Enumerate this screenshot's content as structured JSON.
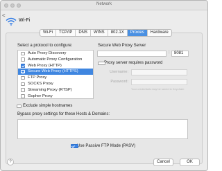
{
  "window": {
    "title": "Network"
  },
  "header": {
    "back_label": "<",
    "interface_name": "Wi-Fi"
  },
  "tabs": [
    {
      "label": "Wi-Fi",
      "active": false
    },
    {
      "label": "TCP/IP",
      "active": false
    },
    {
      "label": "DNS",
      "active": false
    },
    {
      "label": "WINS",
      "active": false
    },
    {
      "label": "802.1X",
      "active": false
    },
    {
      "label": "Proxies",
      "active": true
    },
    {
      "label": "Hardware",
      "active": false
    }
  ],
  "protocols": {
    "heading": "Select a protocol to configure:",
    "items": [
      {
        "label": "Auto Proxy Discovery",
        "checked": false,
        "selected": false
      },
      {
        "label": "Automatic Proxy Configuration",
        "checked": false,
        "selected": false
      },
      {
        "label": "Web Proxy (HTTP)",
        "checked": true,
        "selected": false
      },
      {
        "label": "Secure Web Proxy (HTTPS)",
        "checked": true,
        "selected": true
      },
      {
        "label": "FTP Proxy",
        "checked": false,
        "selected": false
      },
      {
        "label": "SOCKS Proxy",
        "checked": false,
        "selected": false
      },
      {
        "label": "Streaming Proxy (RTSP)",
        "checked": false,
        "selected": false
      },
      {
        "label": "Gopher Proxy",
        "checked": false,
        "selected": false
      }
    ],
    "exclude_simple_hostnames": {
      "label": "Exclude simple hostnames",
      "checked": false
    }
  },
  "server": {
    "heading": "Secure Web Proxy Server",
    "host": "",
    "colon": ":",
    "port": "8081",
    "requires_password": {
      "label": "Proxy server requires password",
      "checked": false
    },
    "username_label": "Username:",
    "password_label": "Password:",
    "hint": "Your credentials may be saved in Keychain"
  },
  "bypass": {
    "heading": "Bypass proxy settings for these Hosts & Domains:",
    "value": ""
  },
  "passive_ftp": {
    "label": "Use Passive FTP Mode (PASV)",
    "checked": true
  },
  "footer": {
    "help_label": "?",
    "cancel_label": "Cancel",
    "ok_label": "OK"
  },
  "colors": {
    "accent": "#3f86e0",
    "window_bg": "#ececec"
  }
}
